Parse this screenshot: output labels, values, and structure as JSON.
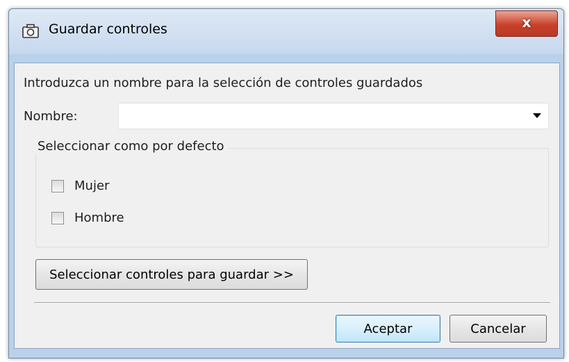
{
  "window": {
    "title": "Guardar controles",
    "close_label": "x"
  },
  "form": {
    "instruction": "Introduzca un nombre para la selección de controles guardados",
    "name_label": "Nombre:",
    "name_value": ""
  },
  "defaults_group": {
    "legend": "Seleccionar como por defecto",
    "options": [
      {
        "label": "Mujer",
        "checked": false
      },
      {
        "label": "Hombre",
        "checked": false
      }
    ]
  },
  "buttons": {
    "select_controls": "Seleccionar controles para guardar >>",
    "ok": "Aceptar",
    "cancel": "Cancelar"
  },
  "icons": {
    "title": "camera-icon",
    "combo": "dropdown-arrow-icon"
  }
}
